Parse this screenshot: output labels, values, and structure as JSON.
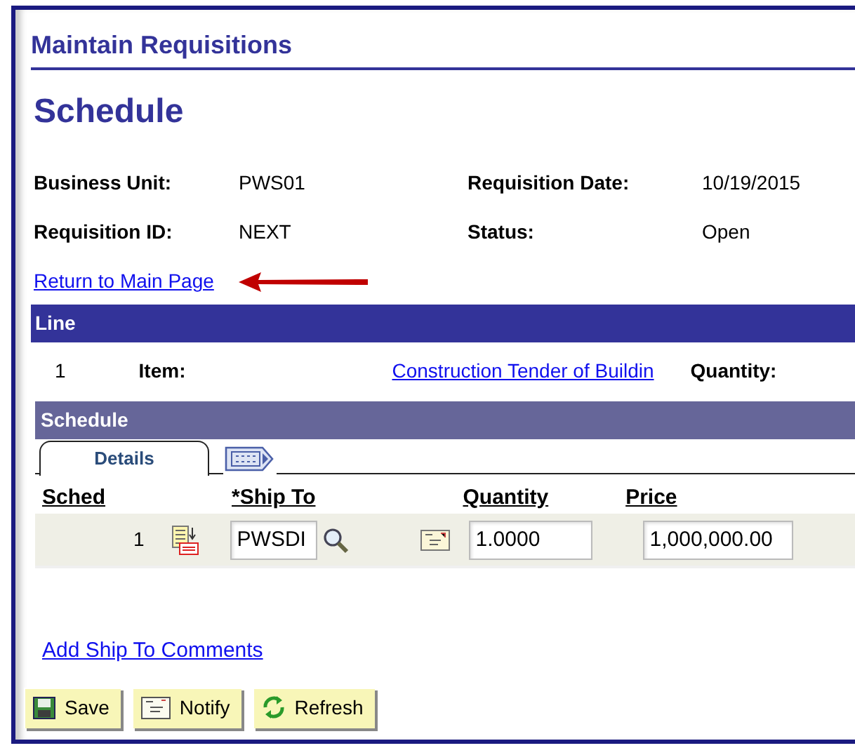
{
  "window": {
    "title": "Maintain Requisitions"
  },
  "page_title": "Schedule",
  "fields": [
    {
      "label": "Business Unit:",
      "value": "PWS01"
    },
    {
      "label": "Requisition Date:",
      "value": "10/19/2015"
    },
    {
      "label": "Requisition ID:",
      "value": "NEXT"
    },
    {
      "label": "Status:",
      "value": "Open"
    }
  ],
  "return_link": "Return to Main Page",
  "line": {
    "header": "Line",
    "number": "1",
    "item_label": "Item:",
    "item_link": "Construction Tender of Buildin",
    "quantity_label": "Quantity:"
  },
  "schedule": {
    "header": "Schedule",
    "tabs": [
      {
        "kind": "text",
        "label": "Details",
        "selected": true
      },
      {
        "kind": "icon",
        "selected": false
      }
    ],
    "columns": [
      "Sched",
      "*Ship To",
      "Quantity",
      "Price"
    ],
    "rows": [
      {
        "sched": "1",
        "ship_to": "PWSDI",
        "quantity": "1.0000",
        "price": "1,000,000.00"
      }
    ]
  },
  "comments_link": "Add Ship To Comments",
  "buttons": [
    {
      "kind": "save",
      "label": "Save"
    },
    {
      "kind": "notify",
      "label": "Notify"
    },
    {
      "kind": "refresh",
      "label": "Refresh"
    }
  ]
}
